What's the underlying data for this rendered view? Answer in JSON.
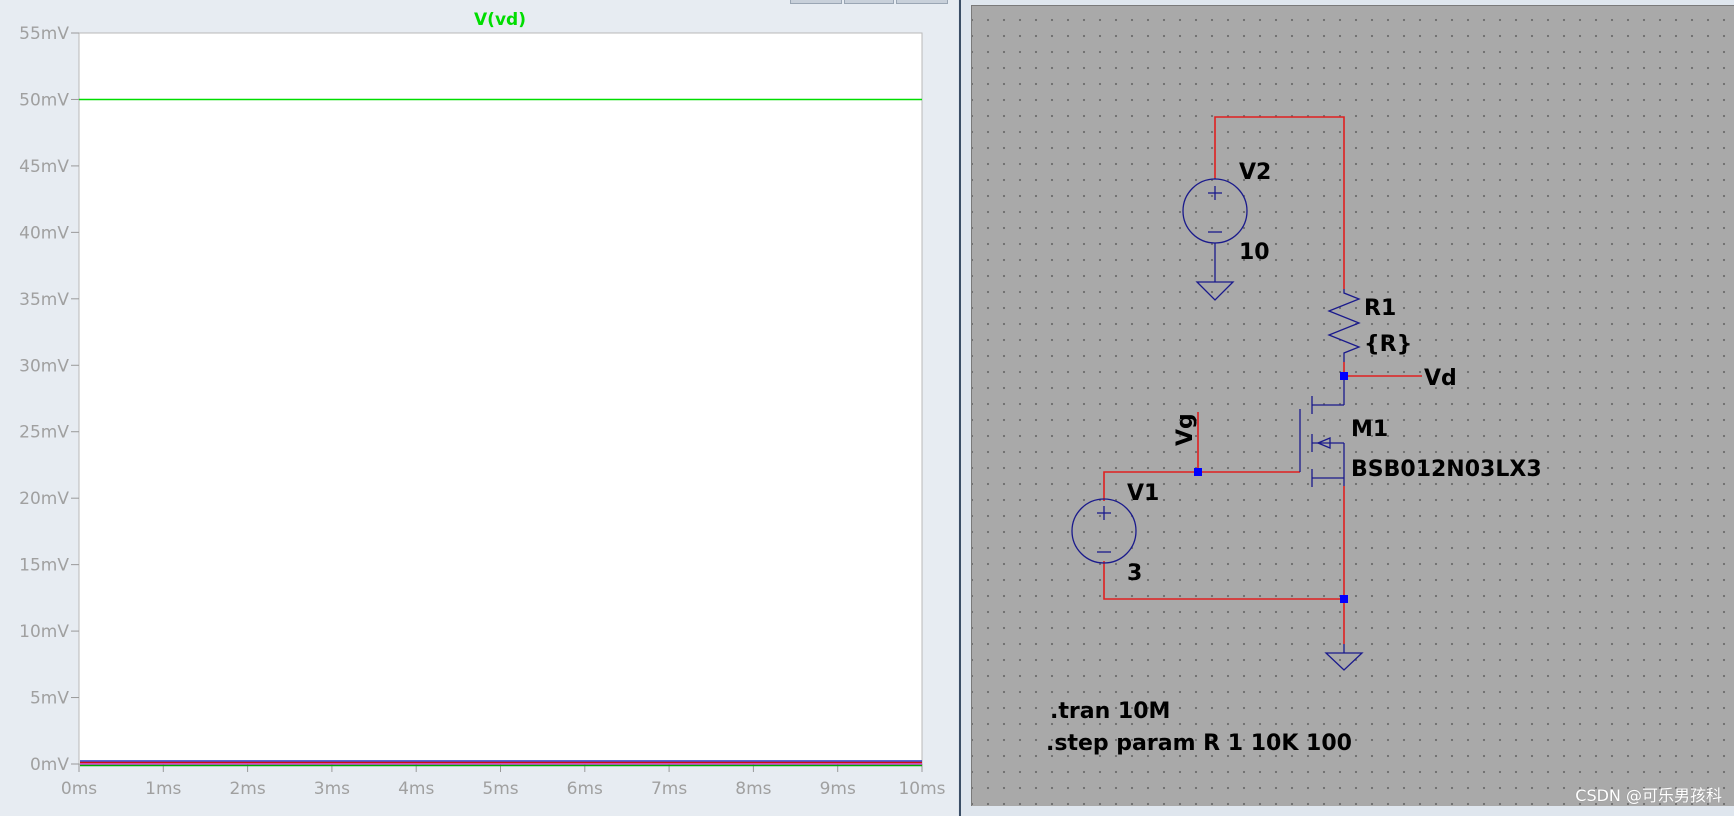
{
  "waveform": {
    "trace_label": "V(vd)",
    "trace_color": "#00dd00",
    "step_trace_colors": [
      "#2233cc",
      "#cc1111",
      "#cc33cc",
      "#00aa00"
    ],
    "y_ticks": [
      "55mV",
      "50mV",
      "45mV",
      "40mV",
      "35mV",
      "30mV",
      "25mV",
      "20mV",
      "15mV",
      "10mV",
      "5mV",
      "0mV"
    ],
    "x_ticks": [
      "0ms",
      "1ms",
      "2ms",
      "3ms",
      "4ms",
      "5ms",
      "6ms",
      "7ms",
      "8ms",
      "9ms",
      "10ms"
    ]
  },
  "chart_data": {
    "type": "line",
    "title": "V(vd)",
    "xlabel": "",
    "ylabel": "",
    "xlim": [
      0,
      10
    ],
    "ylim": [
      0,
      55
    ],
    "x_unit": "ms",
    "y_unit": "mV",
    "grid": false,
    "series": [
      {
        "name": "V(vd)",
        "x": [
          0,
          10
        ],
        "values": [
          50,
          50
        ]
      }
    ]
  },
  "schematic": {
    "labels": {
      "v2_name": "V2",
      "v2_value": "10",
      "r1_name": "R1",
      "r1_value": "{R}",
      "vd_net": "Vd",
      "m1_name": "M1",
      "m1_model": "BSB012N03LX3",
      "vg_net": "Vg",
      "v1_name": "V1",
      "v1_value": "3"
    },
    "directives": {
      "tran": ".tran 10M",
      "step": ".step param R 1 10K 100"
    },
    "wire_color": "#e02020",
    "component_color": "#1a1a8c",
    "junction_color": "#0000ff"
  },
  "watermark": "CSDN @可乐男孩科"
}
